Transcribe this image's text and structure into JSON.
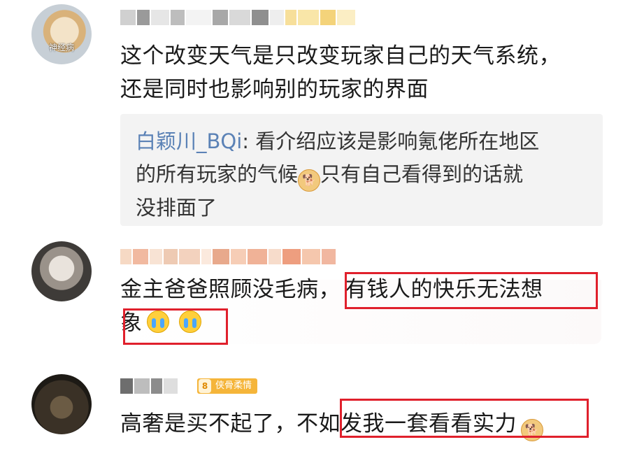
{
  "comments": [
    {
      "avatar_tag": "神经病",
      "text_lines": [
        "这个改变天气是只改变玩家自己的天气系统，",
        "还是同时也影响别的玩家的界面"
      ],
      "reply": {
        "author": "白颖川_BQi",
        "separator": ": ",
        "line1": "看介绍应该是影响氪佬所在地区",
        "line2_before": "的所有玩家的气候",
        "line2_after": "只有自己看得到的话就",
        "line3": "没排面了"
      }
    },
    {
      "text_line1_part1": "金主爸爸照顾没毛病，",
      "text_line1_part2": "有钱人的快乐无法想",
      "text_line2": "象"
    },
    {
      "badge_icon_text": "8",
      "badge_label": "侠骨柔情",
      "text_part1": "高奢是买不起了，不",
      "text_part2": "如发我一套看看实力"
    }
  ],
  "icons": {
    "doge": "doge-icon",
    "cry": "cry-icon"
  },
  "colors": {
    "highlight_box": "#e0202c",
    "reply_author": "#5b82b6",
    "badge": "#f5b53a"
  }
}
